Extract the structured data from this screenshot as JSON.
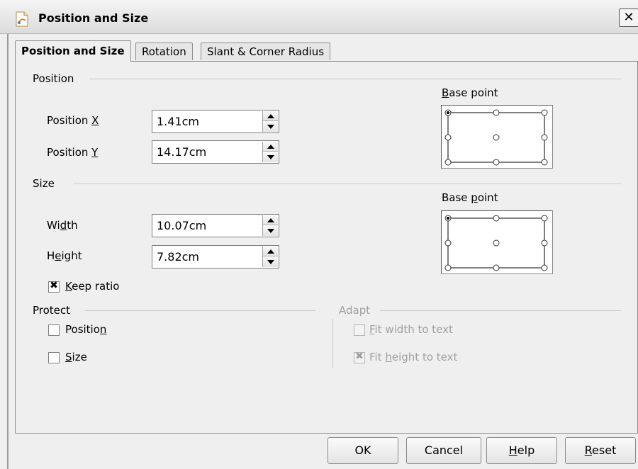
{
  "window": {
    "title": "Position and Size",
    "close_symbol": "✕"
  },
  "tabs": [
    {
      "label": "Position and Size",
      "active": true
    },
    {
      "label": "Rotation",
      "active": false
    },
    {
      "label": "Slant & Corner Radius",
      "active": false
    }
  ],
  "position": {
    "group_label": "Position",
    "x_label_prefix": "Position ",
    "x_label_key": "X",
    "x_value": "1.41cm",
    "y_label_prefix": "Position ",
    "y_label_key": "Y",
    "y_value": "14.17cm",
    "base_point_key": "B",
    "base_point_rest": "ase point",
    "base_point_selected": "top-left"
  },
  "size": {
    "group_label": "Size",
    "width_pre": "Wi",
    "width_key": "d",
    "width_post": "th",
    "width_value": "10.07cm",
    "height_pre": "H",
    "height_key": "e",
    "height_post": "ight",
    "height_value": "7.82cm",
    "keep_ratio_key": "K",
    "keep_ratio_rest": "eep ratio",
    "keep_ratio_checked": true,
    "base_point_pre": "Base ",
    "base_point_key": "p",
    "base_point_post": "oint",
    "base_point_selected": "top-left"
  },
  "protect": {
    "group_label": "Protect",
    "position_pre": "Positio",
    "position_key": "n",
    "position_checked": false,
    "size_key": "S",
    "size_rest": "ize",
    "size_checked": false
  },
  "adapt": {
    "group_label": "Adapt",
    "fit_width_key": "F",
    "fit_width_rest": "it width to text",
    "fit_width_checked": false,
    "fit_height_pre": "Fit ",
    "fit_height_key": "h",
    "fit_height_post": "eight to text",
    "fit_height_checked": true
  },
  "buttons": {
    "ok": "OK",
    "cancel": "Cancel",
    "help_key": "H",
    "help_rest": "elp",
    "reset_key": "R",
    "reset_rest": "eset"
  },
  "colors": {
    "disabled_text": "#a0a0a0",
    "frame": "#8d8d8d",
    "background": "#efefef"
  },
  "icons": {
    "app": "draw-app-icon",
    "checkmark": "✖"
  }
}
